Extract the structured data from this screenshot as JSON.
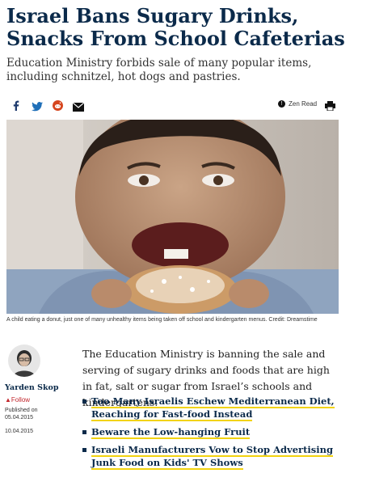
{
  "article": {
    "headline": "Israel Bans Sugary Drinks, Snacks From School Cafeterias",
    "subheadline": "Education Ministry forbids sale of many popular items, including schnitzel, hot dogs and pastries.",
    "share": {
      "icons": [
        "facebook-icon",
        "twitter-icon",
        "reddit-icon",
        "email-icon"
      ],
      "zen_read_label": "Zen Read",
      "print_icon": "printer-icon"
    },
    "image_caption": "A child eating a donut, just one of many unhealthy items being taken off school and kindergarten menus.  Credit: Dreamstime",
    "author": {
      "name": "Yarden Skop",
      "follow_label": "Follow",
      "published_label": "Published on",
      "published_date": "05.04.2015",
      "updated_date": "10.04.2015"
    },
    "lead_paragraph": "The Education Ministry is banning the sale and serving of sugary drinks and foods that are high in fat, salt or sugar from Israel’s schools and kindergartens.",
    "related_links": [
      "Too Many Israelis Eschew Mediterranean Diet, Reaching for Fast-food Instead",
      "Beware the Low-hanging Fruit",
      "Israeli Manufacturers Vow to Stop Advertising Junk Food on Kids' TV Shows"
    ]
  },
  "colors": {
    "headline": "#0b2a4a",
    "follow": "#c2272d",
    "link_underline": "#f2d30f"
  }
}
